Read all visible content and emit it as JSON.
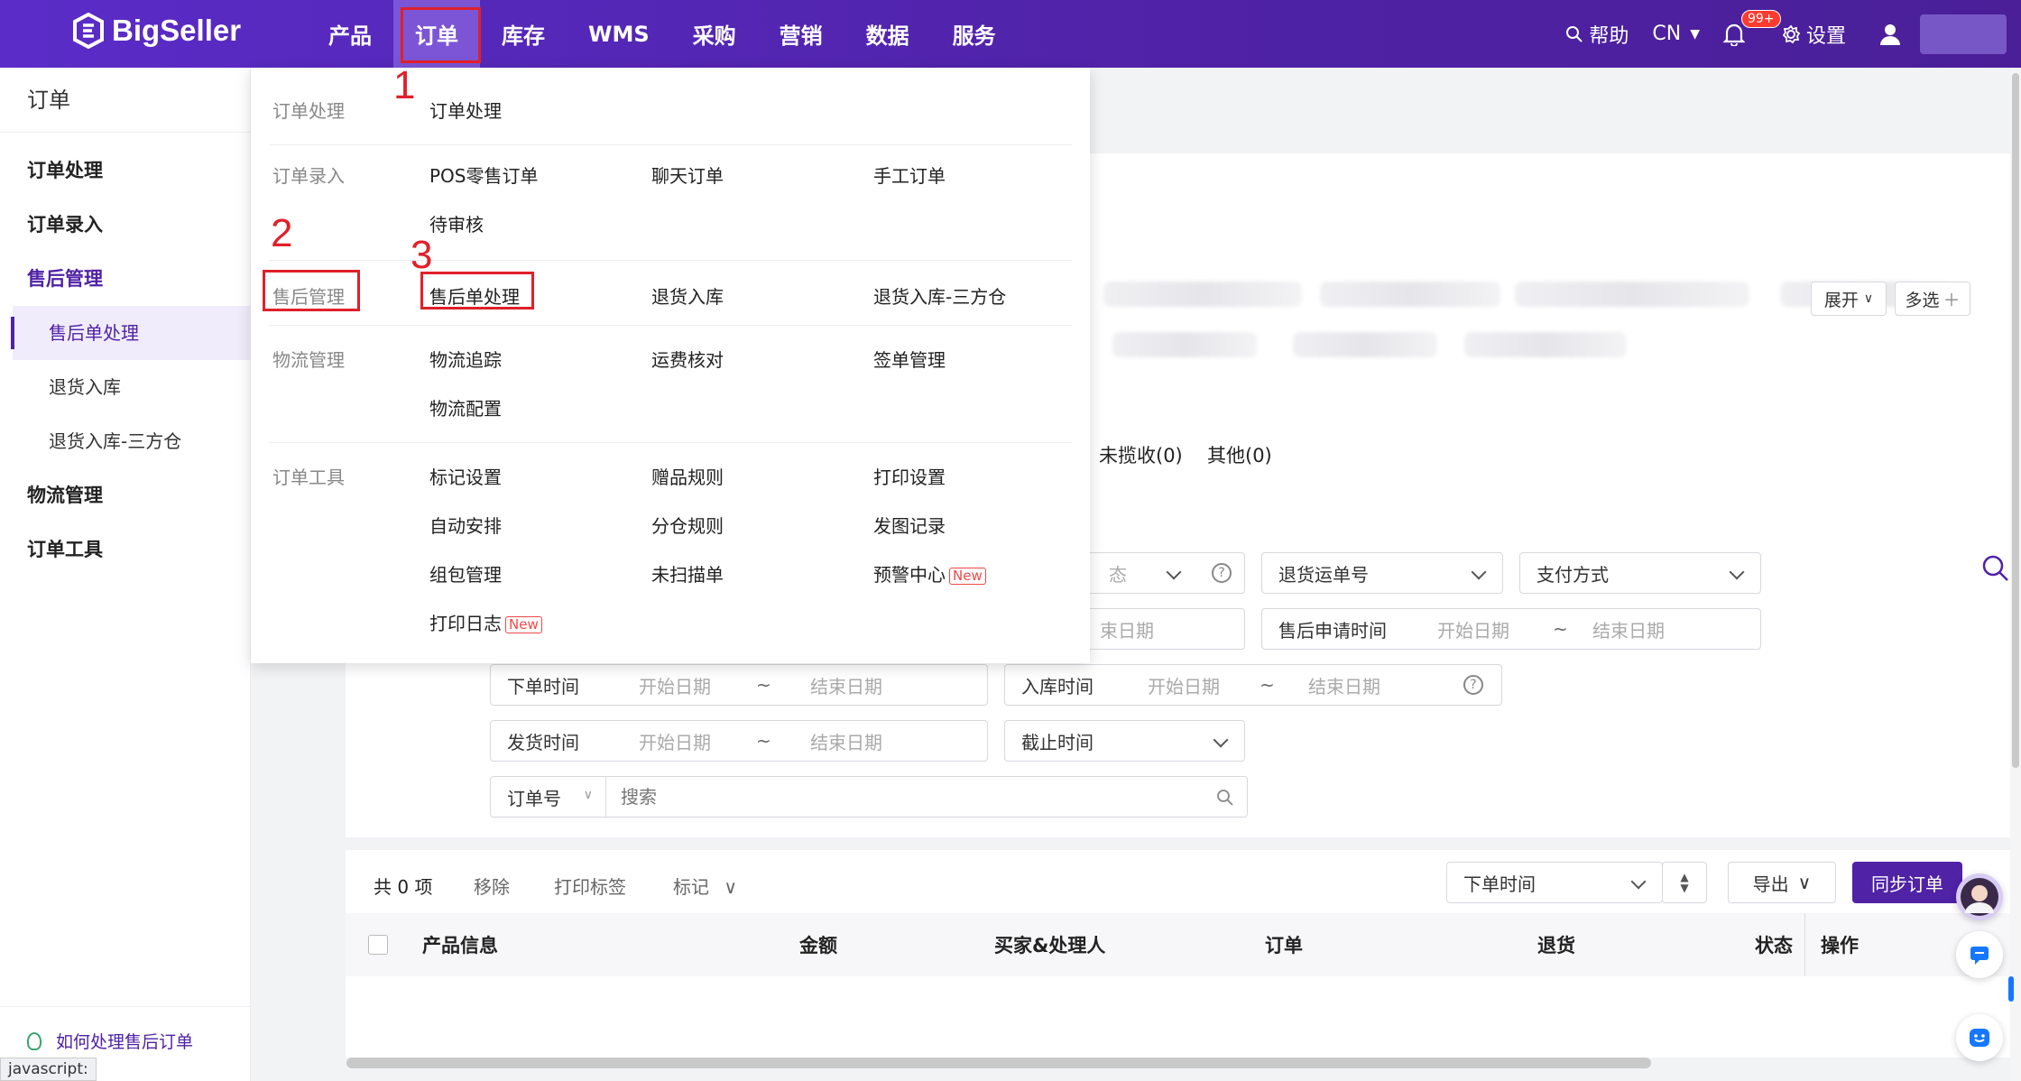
{
  "brand": {
    "name": "BigSeller"
  },
  "nav": [
    {
      "label": "产品"
    },
    {
      "label": "订单"
    },
    {
      "label": "库存"
    },
    {
      "label": "WMS"
    },
    {
      "label": "采购"
    },
    {
      "label": "营销"
    },
    {
      "label": "数据"
    },
    {
      "label": "服务"
    }
  ],
  "topright": {
    "help": "帮助",
    "lang": "CN",
    "badge": "99+",
    "settings": "设置"
  },
  "sidebar": {
    "title": "订单",
    "groups": {
      "g1": "订单处理",
      "g2": "订单录入",
      "g3": "售后管理",
      "g3_items": [
        "售后单处理",
        "退货入库",
        "退货入库-三方仓"
      ],
      "g4": "物流管理",
      "g5": "订单工具"
    },
    "help_link": "如何处理售后订单"
  },
  "status_text": "javascript:",
  "menu": {
    "rows": [
      {
        "category": "订单处理",
        "links": [
          "订单处理"
        ]
      },
      {
        "category": "订单录入",
        "links": [
          "POS零售订单",
          "聊天订单",
          "手工订单",
          "待审核"
        ]
      },
      {
        "category": "售后管理",
        "links": [
          "售后单处理",
          "退货入库",
          "退货入库-三方仓"
        ]
      },
      {
        "category": "物流管理",
        "links": [
          "物流追踪",
          "运费核对",
          "签单管理",
          "物流配置"
        ]
      },
      {
        "category": "订单工具",
        "links": [
          "标记设置",
          "赠品规则",
          "打印设置",
          "自动安排",
          "分仓规则",
          "发图记录",
          "组包管理",
          "未扫描单",
          "预警中心",
          "打印日志"
        ]
      }
    ],
    "new_tag": "New"
  },
  "annotations": [
    "1",
    "2",
    "3"
  ],
  "filters": {
    "expand": "展开",
    "multi": "多选",
    "tabs_tail": [
      "未揽收(0)",
      "其他(0)"
    ],
    "return_tracking": "退货运单号",
    "payment": "支付方式",
    "end_date_partial": "束日期",
    "aftersale_time": "售后申请时间",
    "order_time": "下单时间",
    "stock_in_time": "入库时间",
    "ship_time": "发货时间",
    "deadline": "截止时间",
    "start_date": "开始日期",
    "end_date": "结束日期",
    "tilde": "~",
    "order_no": "订单号",
    "search_placeholder": "搜索",
    "partial_dropdown": "态"
  },
  "toolbar": {
    "count": "共 0 项",
    "remove": "移除",
    "print_label": "打印标签",
    "mark": "标记",
    "sort": "下单时间",
    "export": "导出",
    "sync": "同步订单"
  },
  "table": {
    "headers": [
      "产品信息",
      "金额",
      "买家&处理人",
      "订单",
      "退货",
      "状态",
      "操作"
    ]
  },
  "colors": {
    "brand": "#4f22a6",
    "annotation": "#e0202a"
  }
}
